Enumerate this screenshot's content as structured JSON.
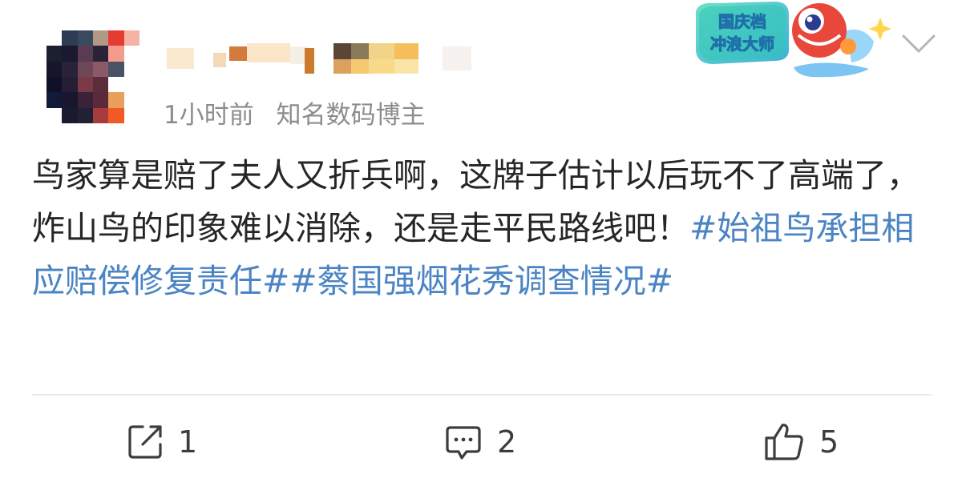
{
  "post": {
    "time": "1小时前",
    "source": "知名数码博主",
    "body_text": "鸟家算是赔了夫人又折兵啊，这牌子估计以后玩不了高端了，炸山鸟的印象难以消除，还是走平民路线吧！",
    "hashtags": [
      "#始祖鸟承担相应赔偿修复责任#",
      "#蔡国强烟花秀调查情况#"
    ]
  },
  "badge": {
    "line1": "国庆档",
    "line2": "冲浪大师"
  },
  "actions": {
    "share_count": "1",
    "comment_count": "2",
    "like_count": "5"
  },
  "icons": {
    "share": "share-icon",
    "comment": "comment-icon",
    "like": "thumbs-up-icon",
    "more": "chevron-down-icon"
  },
  "colors": {
    "hashtag": "#4b84c4",
    "meta": "#8c8c8c",
    "body": "#262626"
  }
}
